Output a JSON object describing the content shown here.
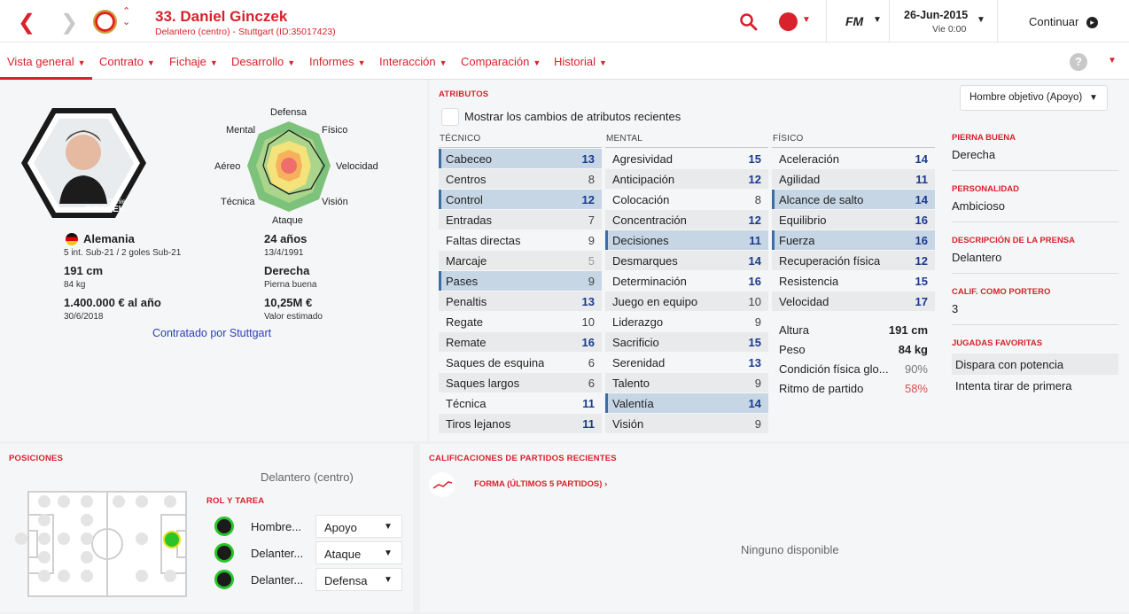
{
  "header": {
    "player_title": "33. Daniel Ginczek",
    "player_subtitle": "Delantero (centro) - Stuttgart (ID:35017423)",
    "fm_label": "FM",
    "date": "26-Jun-2015",
    "day_time": "Vie 0:00",
    "continue_label": "Continuar"
  },
  "nav": {
    "items": [
      "Vista general",
      "Contrato",
      "Fichaje",
      "Desarrollo",
      "Informes",
      "Interacción",
      "Comparación",
      "Historial"
    ],
    "help": "?"
  },
  "profile": {
    "nationality": "Alemania",
    "intl": "5 int. Sub-21 / 2 goles Sub-21",
    "height": "191 cm",
    "weight": "84 kg",
    "wage": "1.400.000 € al año",
    "contract_end": "30/6/2018",
    "age": "24 años",
    "dob": "13/4/1991",
    "foot": "Derecha",
    "foot_label": "Pierna buena",
    "value": "10,25M €",
    "value_label": "Valor estimado",
    "contracted_by": "Contratado por Stuttgart",
    "photo_caption_1": "Daniel",
    "photo_caption_2": "GINCZEK"
  },
  "radar": {
    "labels": {
      "top": "Defensa",
      "tl": "Mental",
      "tr": "Físico",
      "l": "Aéreo",
      "r": "Velocidad",
      "bl": "Técnica",
      "br": "Visión",
      "bottom": "Ataque"
    }
  },
  "attributes": {
    "section_title": "ATRIBUTOS",
    "view_select": "Hombre objetivo (Apoyo)",
    "show_changes_label": "Mostrar los cambios de atributos recientes",
    "col_tecnico": "TÉCNICO",
    "col_mental": "MENTAL",
    "col_fisico": "FÍSICO",
    "tecnico": [
      {
        "name": "Cabeceo",
        "value": "13",
        "hl": true
      },
      {
        "name": "Centros",
        "value": "8"
      },
      {
        "name": "Control",
        "value": "12",
        "hl": true
      },
      {
        "name": "Entradas",
        "value": "7"
      },
      {
        "name": "Faltas directas",
        "value": "9"
      },
      {
        "name": "Marcaje",
        "value": "5"
      },
      {
        "name": "Pases",
        "value": "9",
        "hl": true
      },
      {
        "name": "Penaltis",
        "value": "13"
      },
      {
        "name": "Regate",
        "value": "10"
      },
      {
        "name": "Remate",
        "value": "16"
      },
      {
        "name": "Saques de esquina",
        "value": "6"
      },
      {
        "name": "Saques largos",
        "value": "6"
      },
      {
        "name": "Técnica",
        "value": "11"
      },
      {
        "name": "Tiros lejanos",
        "value": "11"
      }
    ],
    "mental": [
      {
        "name": "Agresividad",
        "value": "15"
      },
      {
        "name": "Anticipación",
        "value": "12"
      },
      {
        "name": "Colocación",
        "value": "8"
      },
      {
        "name": "Concentración",
        "value": "12"
      },
      {
        "name": "Decisiones",
        "value": "11",
        "hl": true
      },
      {
        "name": "Desmarques",
        "value": "14"
      },
      {
        "name": "Determinación",
        "value": "16"
      },
      {
        "name": "Juego en equipo",
        "value": "10"
      },
      {
        "name": "Liderazgo",
        "value": "9"
      },
      {
        "name": "Sacrificio",
        "value": "15"
      },
      {
        "name": "Serenidad",
        "value": "13"
      },
      {
        "name": "Talento",
        "value": "9"
      },
      {
        "name": "Valentía",
        "value": "14",
        "hl": true
      },
      {
        "name": "Visión",
        "value": "9"
      }
    ],
    "fisico": [
      {
        "name": "Aceleración",
        "value": "14"
      },
      {
        "name": "Agilidad",
        "value": "11"
      },
      {
        "name": "Alcance de salto",
        "value": "14",
        "hl": true
      },
      {
        "name": "Equilibrio",
        "value": "16"
      },
      {
        "name": "Fuerza",
        "value": "16",
        "hl": true
      },
      {
        "name": "Recuperación física",
        "value": "12"
      },
      {
        "name": "Resistencia",
        "value": "15"
      },
      {
        "name": "Velocidad",
        "value": "17"
      }
    ],
    "extra": [
      {
        "name": "Altura",
        "value": "191 cm"
      },
      {
        "name": "Peso",
        "value": "84 kg"
      },
      {
        "name": "Condición física glo...",
        "value": "90%"
      },
      {
        "name": "Ritmo de partido",
        "value": "58%"
      }
    ]
  },
  "info": {
    "foot_label": "PIERNA BUENA",
    "foot_value": "Derecha",
    "personality_label": "PERSONALIDAD",
    "personality_value": "Ambicioso",
    "press_label": "DESCRIPCIÓN DE LA PRENSA",
    "press_value": "Delantero",
    "gk_label": "CALIF. COMO PORTERO",
    "gk_value": "3",
    "ppm_label": "JUGADAS FAVORITAS",
    "ppm": [
      "Dispara con potencia",
      "Intenta tirar de primera"
    ]
  },
  "positions": {
    "title": "POSICIONES",
    "position": "Delantero (centro)",
    "role_title": "ROL Y TAREA",
    "roles": [
      {
        "name": "Hombre...",
        "duty": "Apoyo"
      },
      {
        "name": "Delanter...",
        "duty": "Ataque"
      },
      {
        "name": "Delanter...",
        "duty": "Defensa"
      }
    ]
  },
  "ratings": {
    "title": "CALIFICACIONES DE PARTIDOS RECIENTES",
    "form_label": "FORMA (ÚLTIMOS 5 PARTIDOS) ›",
    "empty": "Ninguno disponible"
  },
  "colors": {
    "accent": "#d8222c",
    "highlight": "#c6d6e5",
    "number_blue": "#1a3a8c"
  }
}
